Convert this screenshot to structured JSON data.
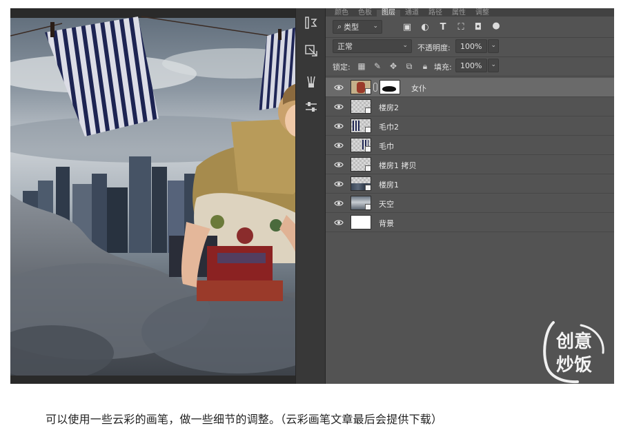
{
  "panel": {
    "tabs": [
      "颜色",
      "色板",
      "图层",
      "通道",
      "路径",
      "属性",
      "调整"
    ],
    "active_tab": "图层",
    "filter": {
      "label": "类型"
    },
    "blend_mode": "正常",
    "opacity_label": "不透明度:",
    "opacity_value": "100%",
    "lock_label": "锁定:",
    "fill_label": "填充:",
    "fill_value": "100%",
    "layers": [
      {
        "name": "女仆",
        "selected": true,
        "has_mask": true
      },
      {
        "name": "楼房2",
        "selected": false,
        "has_mask": false
      },
      {
        "name": "毛巾2",
        "selected": false,
        "has_mask": false
      },
      {
        "name": "毛巾",
        "selected": false,
        "has_mask": false
      },
      {
        "name": "楼房1 拷贝",
        "selected": false,
        "has_mask": false
      },
      {
        "name": "楼房1",
        "selected": false,
        "has_mask": false
      },
      {
        "name": "天空",
        "selected": false,
        "has_mask": false
      },
      {
        "name": "背景",
        "selected": false,
        "has_mask": false
      }
    ]
  },
  "watermark": {
    "line1": "创意",
    "line2": "炒饭"
  },
  "caption": "可以使用一些云彩的画笔，做一些细节的调整。（云彩画笔文章最后会提供下载）",
  "colors": {
    "panel_bg": "#535353",
    "selected_layer": "#6a6a6a",
    "toolbar_bg": "#383838"
  },
  "icons": [
    "search-icon",
    "image-filter-icon",
    "adjustment-filter-icon",
    "type-filter-icon",
    "shape-filter-icon",
    "smartobject-filter-icon",
    "visibility-eye-icon",
    "link-icon",
    "smart-object-badge-icon"
  ]
}
